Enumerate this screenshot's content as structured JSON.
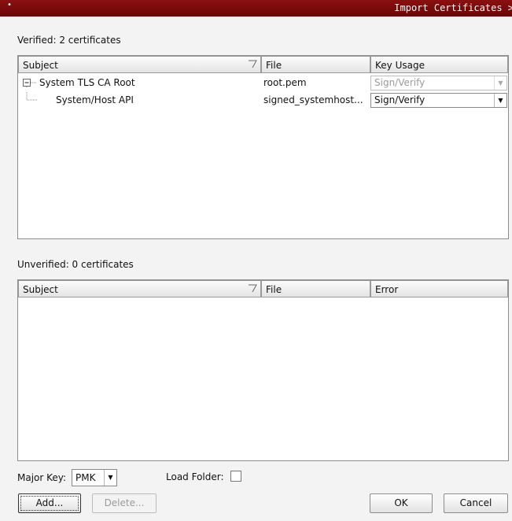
{
  "window": {
    "title": "Import Certificates >",
    "menu_glyph": "•"
  },
  "verified": {
    "label": "Verified: 2 certificates",
    "columns": {
      "subject": "Subject",
      "file": "File",
      "key_usage": "Key Usage"
    },
    "rows": [
      {
        "subject": "System TLS CA Root",
        "file": "root.pem",
        "key_usage": "Sign/Verify",
        "enabled": false
      },
      {
        "subject": "System/Host API",
        "file": "signed_systemhost...",
        "key_usage": "Sign/Verify",
        "enabled": true
      }
    ]
  },
  "unverified": {
    "label": "Unverified: 0 certificates",
    "columns": {
      "subject": "Subject",
      "file": "File",
      "error": "Error"
    }
  },
  "options": {
    "major_key_label": "Major Key:",
    "major_key_value": "PMK",
    "load_folder_label": "Load Folder:",
    "load_folder_checked": false
  },
  "buttons": {
    "add": "Add...",
    "delete": "Delete...",
    "ok": "OK",
    "cancel": "Cancel"
  },
  "icons": {
    "collapse": "collapse-tree-icon",
    "sort": "sort-indicator-icon",
    "dropdown": "chevron-down-icon"
  }
}
